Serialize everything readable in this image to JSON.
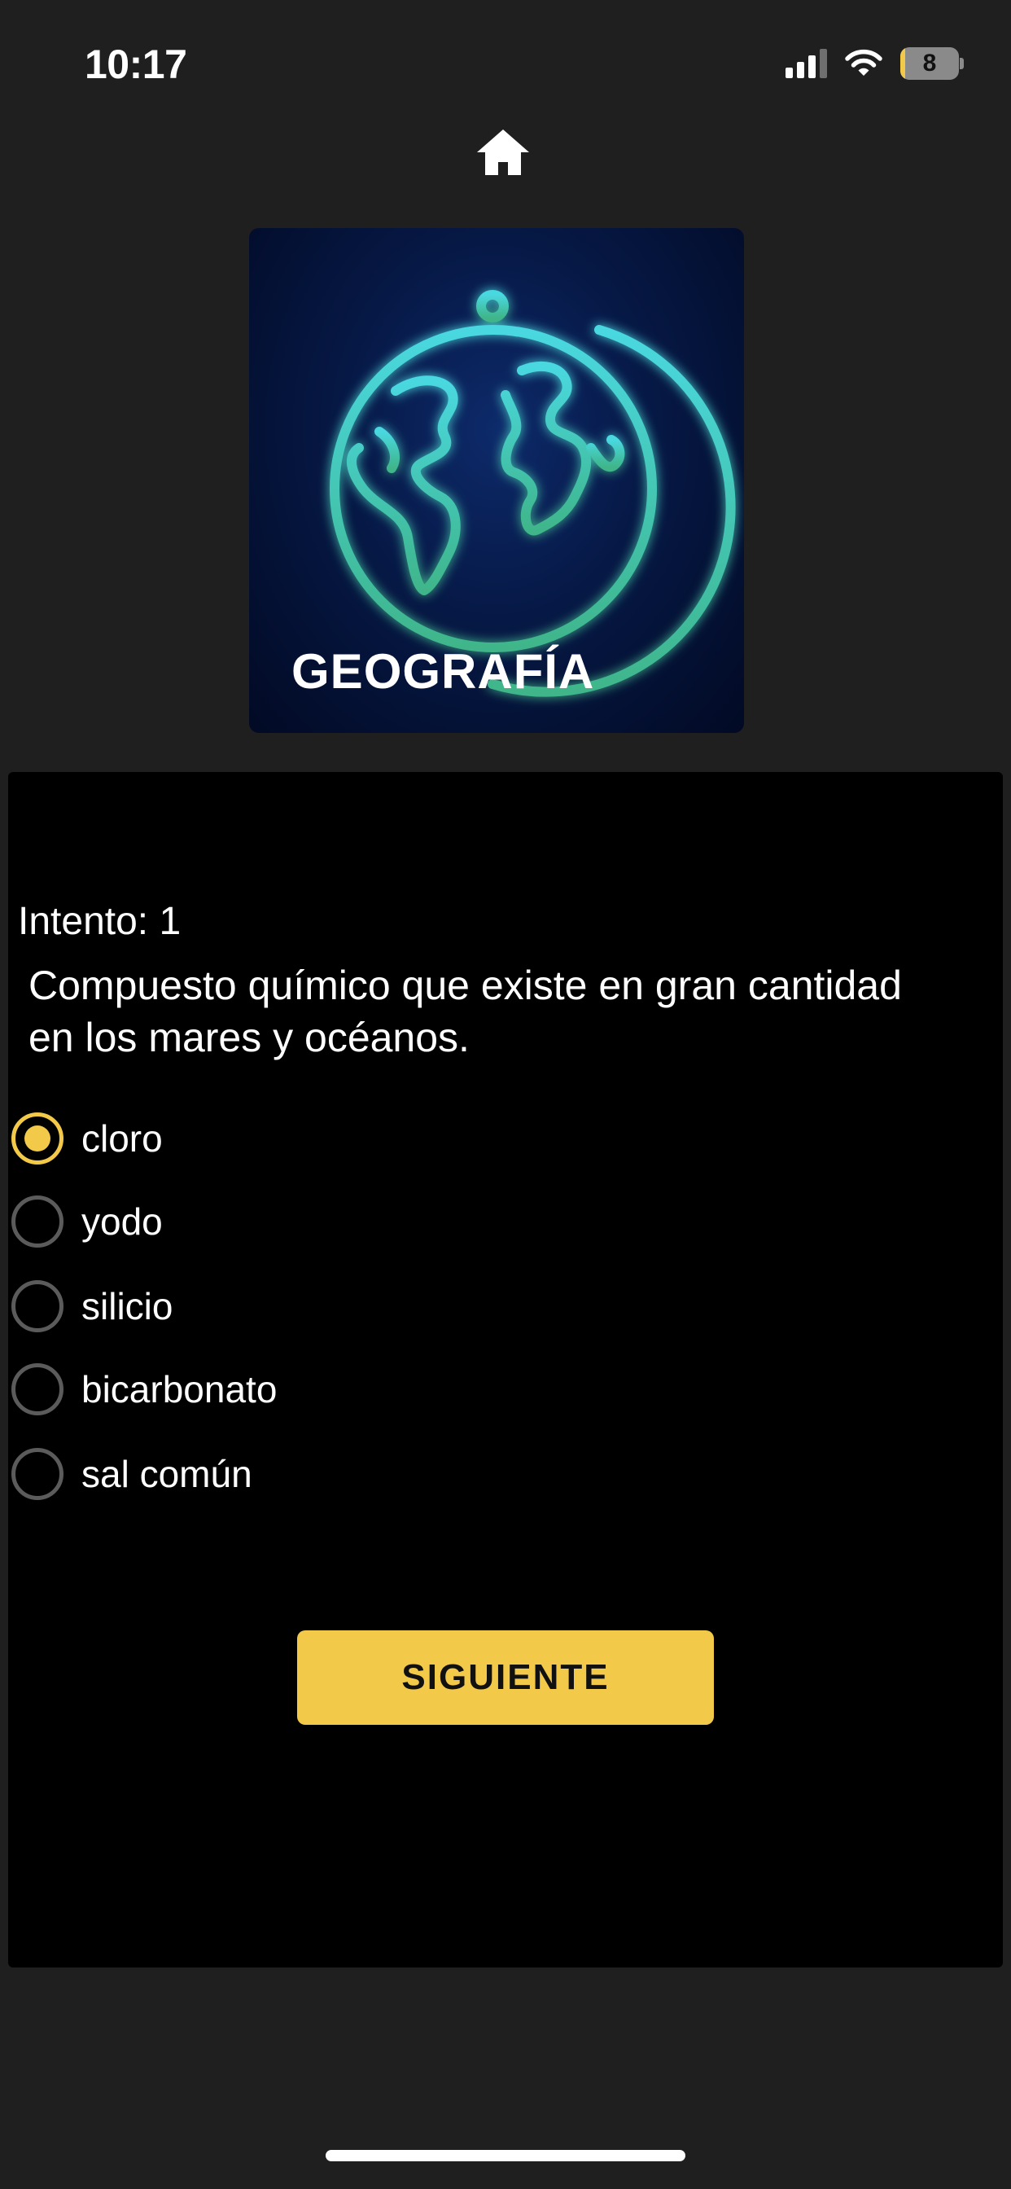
{
  "status_bar": {
    "time": "10:17",
    "battery_level": "8",
    "battery_fraction": 0.08,
    "icons": [
      "signal-icon",
      "wifi-icon",
      "battery-icon"
    ]
  },
  "header": {
    "home_icon": "home-icon"
  },
  "category": {
    "title": "GEOGRAFÍA",
    "image_icon": "neon-globe-icon"
  },
  "quiz": {
    "attempt_text": "Intento: 1",
    "question": "Compuesto químico que existe en gran cantidad en los mares y océanos.",
    "options": [
      {
        "label": "cloro",
        "selected": true
      },
      {
        "label": "yodo",
        "selected": false
      },
      {
        "label": "silicio",
        "selected": false
      },
      {
        "label": "bicarbonato",
        "selected": false
      },
      {
        "label": "sal común",
        "selected": false
      }
    ],
    "next_label": "SIGUIENTE"
  },
  "colors": {
    "background": "#1f1f1f",
    "panel": "#000000",
    "accent": "#f3c94a",
    "radio_border": "#5b5b5b",
    "globe_neon": "#4fd3c8"
  }
}
